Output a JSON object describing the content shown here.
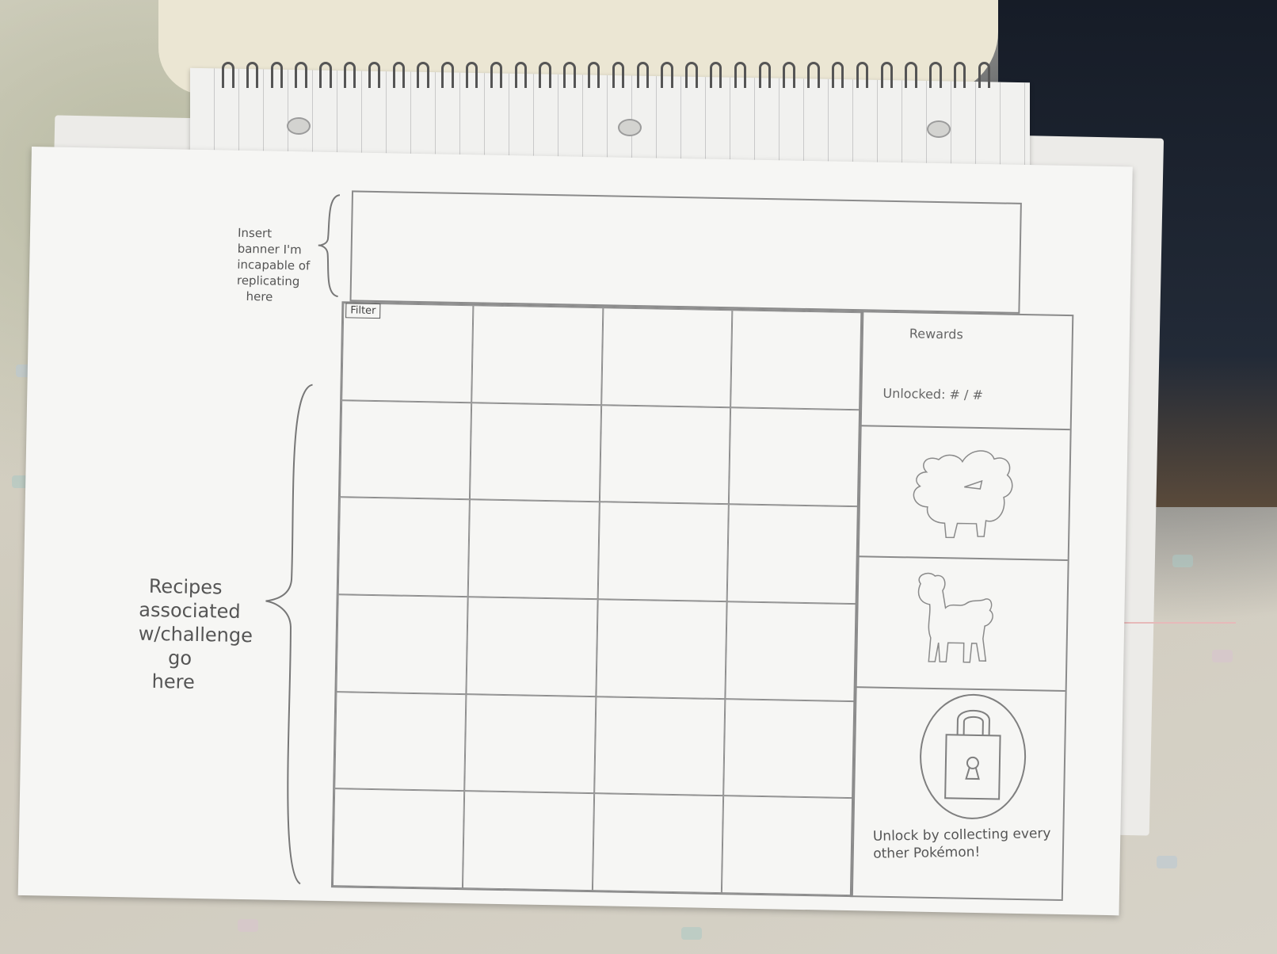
{
  "banner_note": {
    "lines": [
      "Insert",
      "banner I'm",
      "incapable of",
      "replicating",
      "here"
    ]
  },
  "recipes_note": {
    "lines": [
      "Recipes",
      "associated",
      "w/challenge",
      "go",
      "here"
    ]
  },
  "grid": {
    "filter_label": "Filter",
    "rows": 6,
    "cols": 4
  },
  "rewards": {
    "title": "Rewards",
    "unlocked": "Unlocked: # / #",
    "items": [
      {
        "icon": "pokemon-silhouette-icon"
      },
      {
        "icon": "llama-pokemon-silhouette-icon"
      },
      {
        "icon": "lock-icon",
        "caption": "Unlock by collecting every other Pokémon!"
      }
    ]
  },
  "colors": {
    "pencil": "#8b8b8b",
    "paper": "#f6f6f4"
  }
}
